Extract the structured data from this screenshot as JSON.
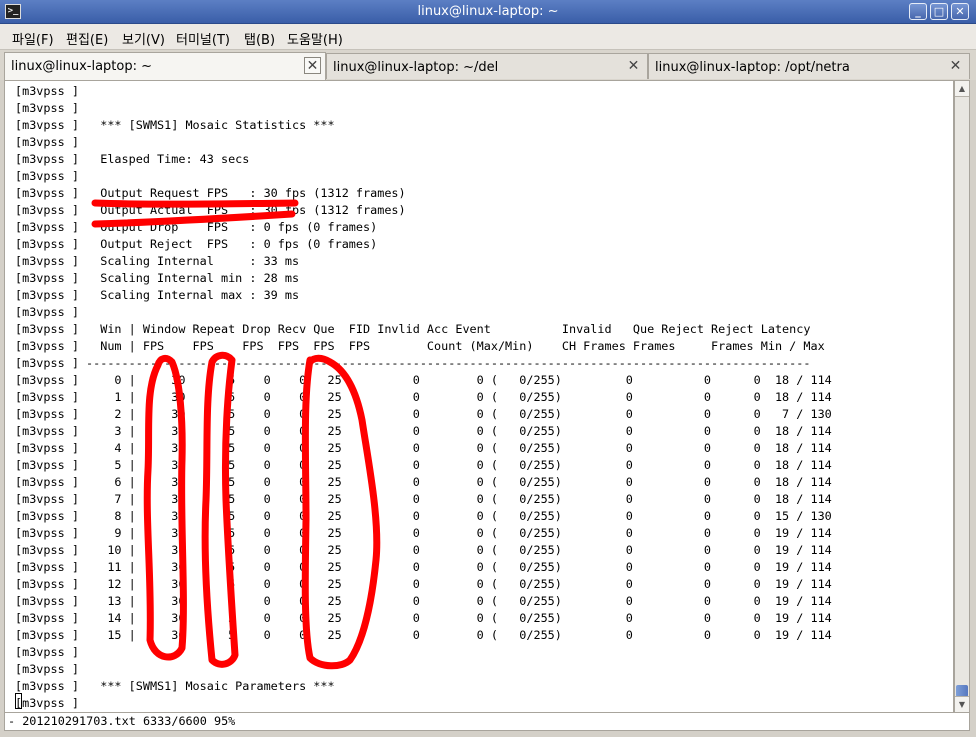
{
  "window": {
    "title": "linux@linux-laptop: ~",
    "icon": "terminal-icon",
    "buttons": {
      "minimize": "_",
      "maximize": "□",
      "close": "✕"
    }
  },
  "menu": [
    "파일(F)",
    "편집(E)",
    "보기(V)",
    "터미널(T)",
    "탭(B)",
    "도움말(H)"
  ],
  "tabs": [
    {
      "label": "linux@linux-laptop: ~",
      "close": "✕"
    },
    {
      "label": "linux@linux-laptop: ~/del",
      "close": "✕"
    },
    {
      "label": "linux@linux-laptop: /opt/netra",
      "close": "✕"
    }
  ],
  "terminal": {
    "lines": [
      "[m3vpss ]",
      "[m3vpss ]",
      "[m3vpss ]   *** [SWMS1] Mosaic Statistics ***",
      "[m3vpss ]",
      "[m3vpss ]   Elasped Time: 43 secs",
      "[m3vpss ]",
      "[m3vpss ]   Output Request FPS   : 30 fps (1312 frames)",
      "[m3vpss ]   Output Actual  FPS   : 30 fps (1312 frames)",
      "[m3vpss ]   Output Drop    FPS   : 0 fps (0 frames)",
      "[m3vpss ]   Output Reject  FPS   : 0 fps (0 frames)",
      "[m3vpss ]   Scaling Internal     : 33 ms",
      "[m3vpss ]   Scaling Internal min : 28 ms",
      "[m3vpss ]   Scaling Internal max : 39 ms",
      "[m3vpss ]",
      "[m3vpss ]   Win | Window Repeat Drop Recv Que  FID Invlid Acc Event          Invalid   Que Reject Reject Latency",
      "[m3vpss ]   Num | FPS    FPS    FPS  FPS  FPS  FPS        Count (Max/Min)    CH Frames Frames     Frames Min / Max",
      "[m3vpss ] ------------------------------------------------------------------------------------------------------",
      "[m3vpss ]     0 |     30      5    0    0   25          0        0 (   0/255)         0          0      0  18 / 114",
      "[m3vpss ]     1 |     30      5    0    0   25          0        0 (   0/255)         0          0      0  18 / 114",
      "[m3vpss ]     2 |     30      5    0    0   25          0        0 (   0/255)         0          0      0   7 / 130",
      "[m3vpss ]     3 |     30      5    0    0   25          0        0 (   0/255)         0          0      0  18 / 114",
      "[m3vpss ]     4 |     30      5    0    0   25          0        0 (   0/255)         0          0      0  18 / 114",
      "[m3vpss ]     5 |     30      5    0    0   25          0        0 (   0/255)         0          0      0  18 / 114",
      "[m3vpss ]     6 |     30      5    0    0   25          0        0 (   0/255)         0          0      0  18 / 114",
      "[m3vpss ]     7 |     30      5    0    0   25          0        0 (   0/255)         0          0      0  18 / 114",
      "[m3vpss ]     8 |     30      5    0    0   25          0        0 (   0/255)         0          0      0  15 / 130",
      "[m3vpss ]     9 |     30      5    0    0   25          0        0 (   0/255)         0          0      0  19 / 114",
      "[m3vpss ]    10 |     30      5    0    0   25          0        0 (   0/255)         0          0      0  19 / 114",
      "[m3vpss ]    11 |     30      5    0    0   25          0        0 (   0/255)         0          0      0  19 / 114",
      "[m3vpss ]    12 |     30      5    0    0   25          0        0 (   0/255)         0          0      0  19 / 114",
      "[m3vpss ]    13 |     30      5    0    0   25          0        0 (   0/255)         0          0      0  19 / 114",
      "[m3vpss ]    14 |     30      5    0    0   25          0        0 (   0/255)         0          0      0  19 / 114",
      "[m3vpss ]    15 |     30      5    0    0   25          0        0 (   0/255)         0          0      0  19 / 114",
      "[m3vpss ]",
      "[m3vpss ]",
      "[m3vpss ]   *** [SWMS1] Mosaic Parameters ***",
      "[m3vpss ]"
    ],
    "status_line": "- 201210291703.txt 6333/6600 95%"
  },
  "annotation_color": "#ff0000"
}
